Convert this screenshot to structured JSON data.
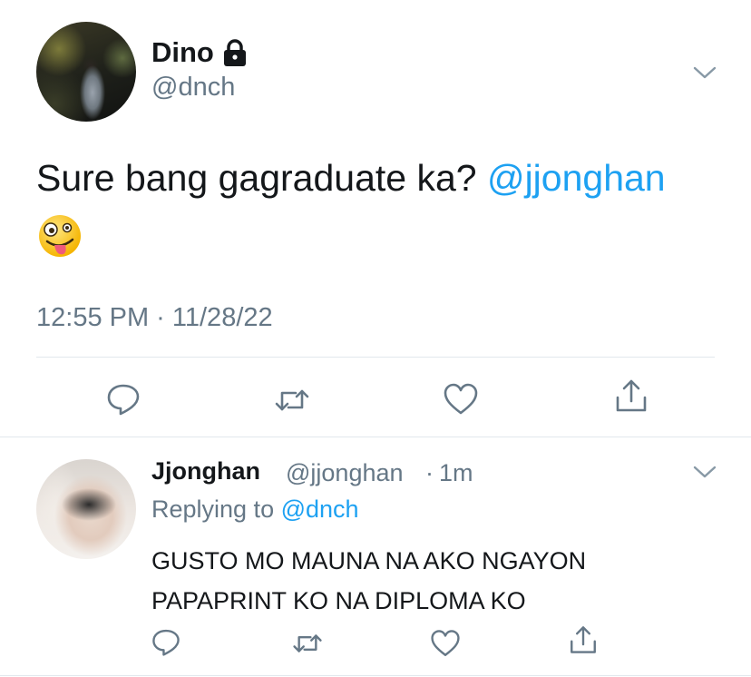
{
  "tweet": {
    "author_name": "Dino",
    "author_handle": "@dnch",
    "text": "Sure bang gagraduate ka? ",
    "mention": "@jjonghan",
    "emoji": "🤪",
    "timestamp": "12:55 PM · 11/28/22"
  },
  "reply": {
    "author_name": "Jjonghan",
    "author_handle": "@jjonghan",
    "separator": "·",
    "time": "1m",
    "replying_to_label": "Replying to",
    "replying_to_handle": "@dnch",
    "text_line1": "GUSTO MO MAUNA NA AKO NGAYON",
    "text_line2": "PAPAPRINT KO NA DIPLOMA KO"
  },
  "icons": [
    "lock-icon",
    "chevron-down-icon",
    "reply-icon",
    "retweet-icon",
    "like-icon",
    "share-icon"
  ],
  "colors": {
    "accent": "#1da1f2",
    "secondary_text": "#657786",
    "primary_text": "#14171a",
    "icon": "#657786",
    "divider": "#e1e8ed"
  }
}
